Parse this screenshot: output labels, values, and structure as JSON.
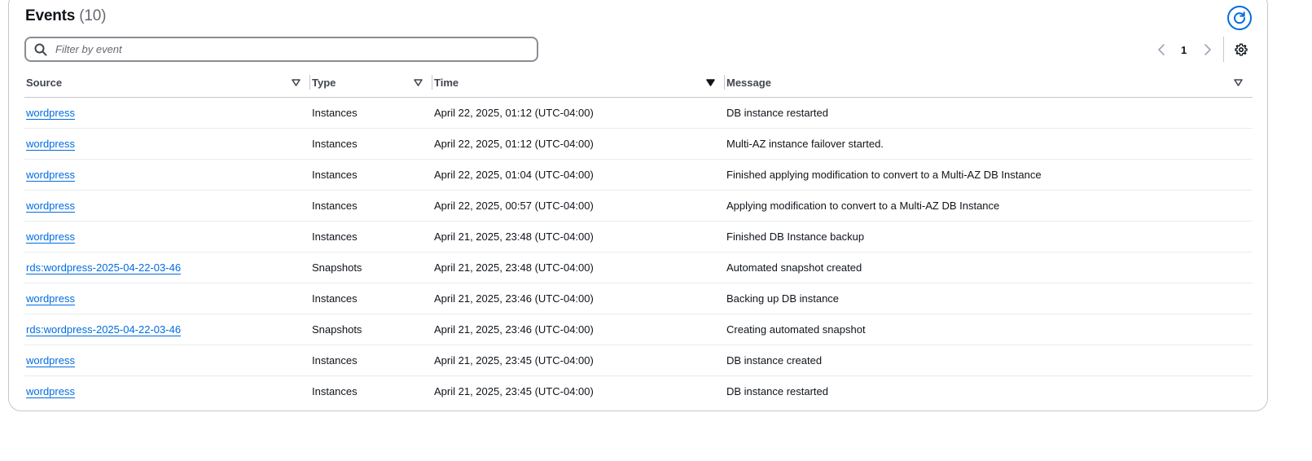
{
  "header": {
    "title": "Events",
    "count": "(10)"
  },
  "search": {
    "placeholder": "Filter by event",
    "value": ""
  },
  "pagination": {
    "current_page": "1"
  },
  "columns": {
    "source": "Source",
    "type": "Type",
    "time": "Time",
    "message": "Message"
  },
  "rows": [
    {
      "source": "wordpress",
      "type": "Instances",
      "time": "April 22, 2025, 01:12 (UTC-04:00)",
      "message": "DB instance restarted"
    },
    {
      "source": "wordpress",
      "type": "Instances",
      "time": "April 22, 2025, 01:12 (UTC-04:00)",
      "message": "Multi-AZ instance failover started."
    },
    {
      "source": "wordpress",
      "type": "Instances",
      "time": "April 22, 2025, 01:04 (UTC-04:00)",
      "message": "Finished applying modification to convert to a Multi-AZ DB Instance"
    },
    {
      "source": "wordpress",
      "type": "Instances",
      "time": "April 22, 2025, 00:57 (UTC-04:00)",
      "message": "Applying modification to convert to a Multi-AZ DB Instance"
    },
    {
      "source": "wordpress",
      "type": "Instances",
      "time": "April 21, 2025, 23:48 (UTC-04:00)",
      "message": "Finished DB Instance backup"
    },
    {
      "source": "rds:wordpress-2025-04-22-03-46",
      "type": "Snapshots",
      "time": "April 21, 2025, 23:48 (UTC-04:00)",
      "message": "Automated snapshot created"
    },
    {
      "source": "wordpress",
      "type": "Instances",
      "time": "April 21, 2025, 23:46 (UTC-04:00)",
      "message": "Backing up DB instance"
    },
    {
      "source": "rds:wordpress-2025-04-22-03-46",
      "type": "Snapshots",
      "time": "April 21, 2025, 23:46 (UTC-04:00)",
      "message": "Creating automated snapshot"
    },
    {
      "source": "wordpress",
      "type": "Instances",
      "time": "April 21, 2025, 23:45 (UTC-04:00)",
      "message": "DB instance created"
    },
    {
      "source": "wordpress",
      "type": "Instances",
      "time": "April 21, 2025, 23:45 (UTC-04:00)",
      "message": "DB instance restarted"
    }
  ],
  "icons": {
    "refresh": "refresh-icon",
    "search": "search-icon",
    "prev": "chevron-left-icon",
    "next": "chevron-right-icon",
    "settings": "gear-icon",
    "sort": "sort-caret-icon"
  },
  "colors": {
    "link": "#006ce0",
    "accent": "#006ce0",
    "border": "#c6c6cd"
  }
}
